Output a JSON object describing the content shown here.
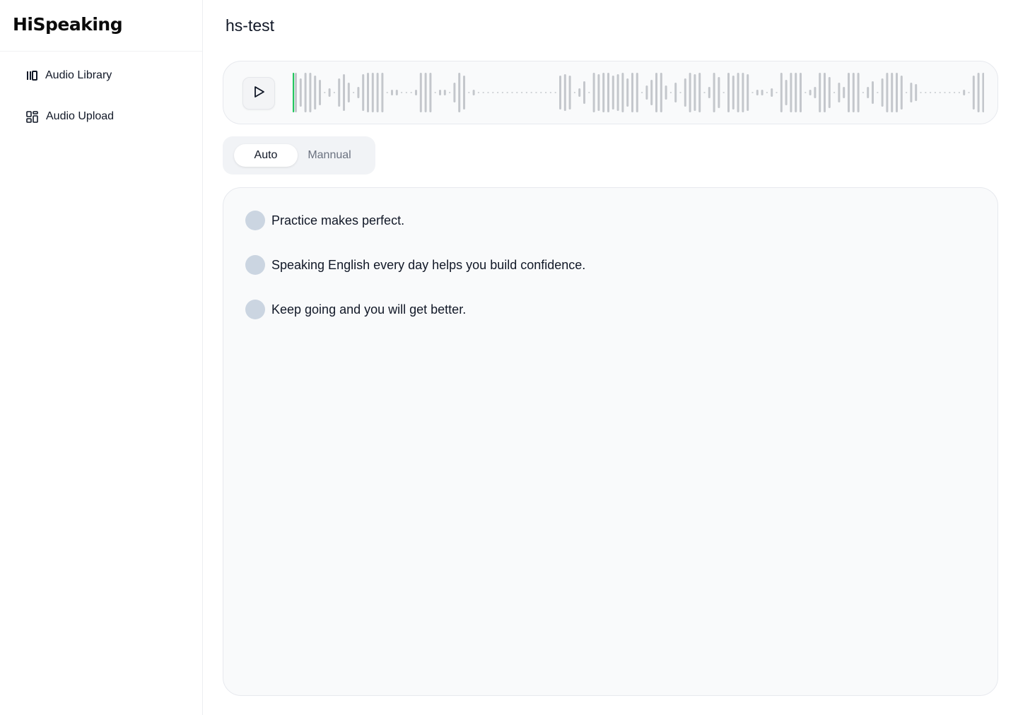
{
  "brand": {
    "name": "HiSpeaking"
  },
  "sidebar": {
    "items": [
      {
        "label": "Audio Library",
        "icon": "library-icon"
      },
      {
        "label": "Audio Upload",
        "icon": "upload-grid-icon"
      }
    ]
  },
  "page": {
    "title": "hs-test"
  },
  "player": {
    "play_icon": "play-icon",
    "progress": 0,
    "colors": {
      "played": "#22c55e",
      "unplayed": "#c4c7cc"
    }
  },
  "mode": {
    "options": [
      "Auto",
      "Mannual"
    ],
    "selected": "Auto"
  },
  "sentences": [
    {
      "text": "Practice makes perfect."
    },
    {
      "text": "Speaking English every day helps you build confidence."
    },
    {
      "text": "Keep going and you will get better."
    }
  ],
  "colors": {
    "accent": "#22c55e",
    "dot": "#cbd5e1",
    "border": "#e7e9ee",
    "panel_bg": "#f9fafb"
  }
}
